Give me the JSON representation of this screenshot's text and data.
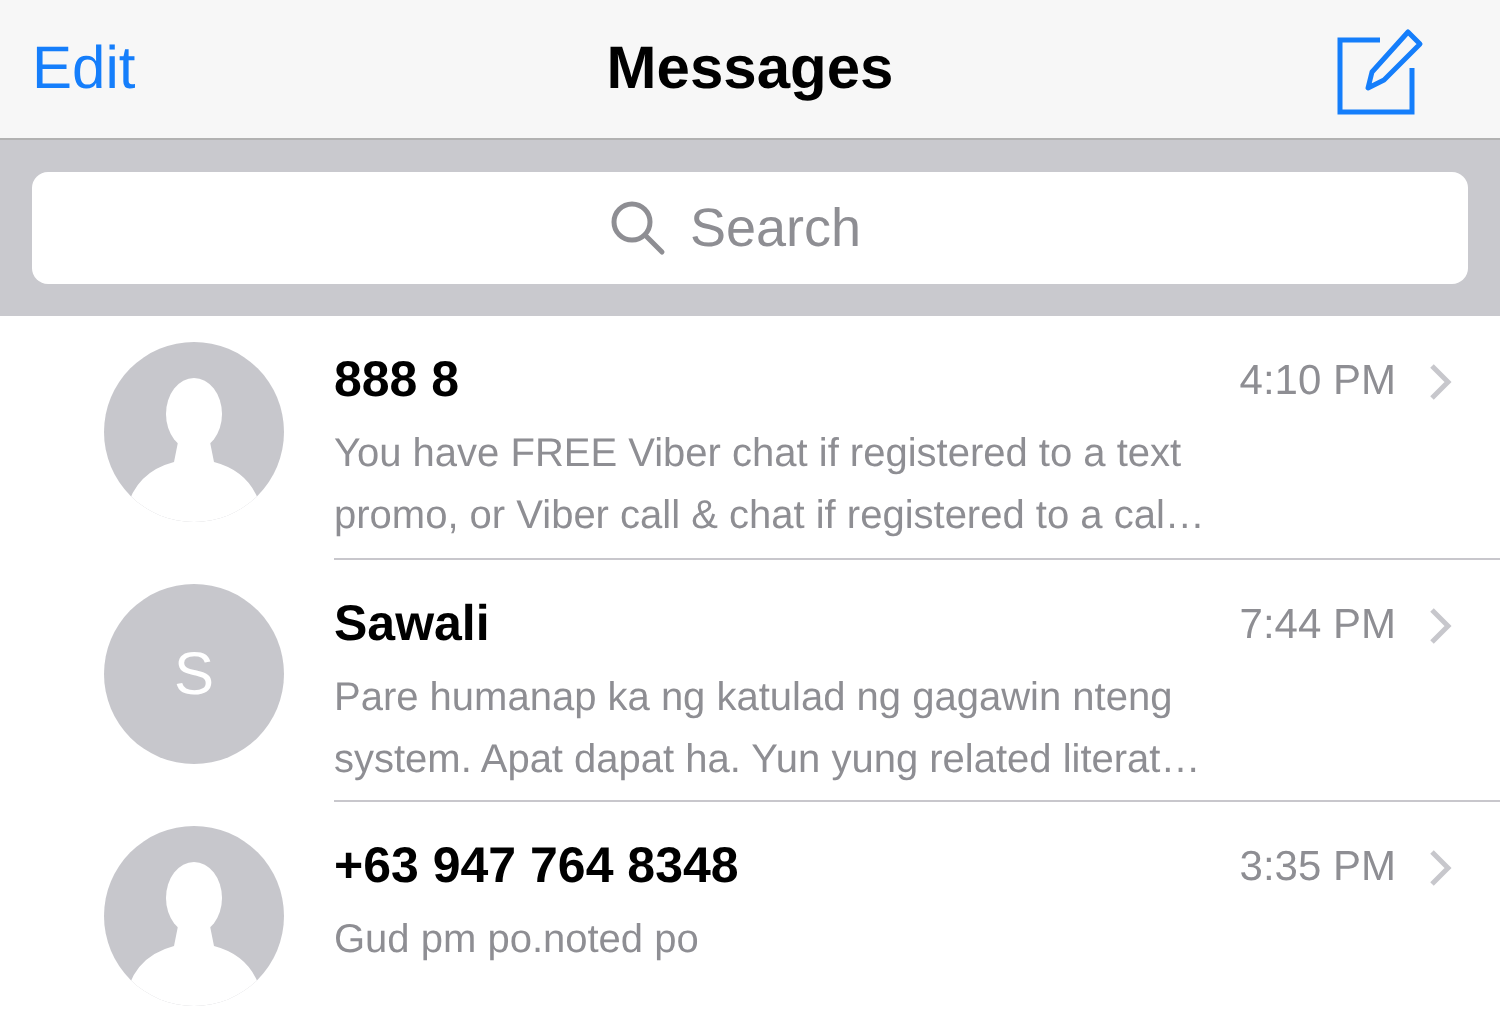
{
  "header": {
    "edit": "Edit",
    "title": "Messages"
  },
  "search": {
    "placeholder": "Search"
  },
  "conversations": [
    {
      "avatar": {
        "kind": "silhouette"
      },
      "name": "888 8",
      "time": "4:10 PM",
      "preview_lines": [
        "You have FREE Viber chat if registered to a text",
        "promo, or Viber call & chat if registered to a cal…"
      ]
    },
    {
      "avatar": {
        "kind": "initial",
        "text": "S"
      },
      "name": "Sawali",
      "time": "7:44 PM",
      "preview_lines": [
        "Pare humanap ka ng katulad ng gagawin nteng",
        "system. Apat dapat ha. Yun yung related literat…"
      ]
    },
    {
      "avatar": {
        "kind": "silhouette"
      },
      "name": "+63 947 764 8348",
      "time": "3:35 PM",
      "preview_lines": [
        "Gud pm po.noted po"
      ]
    }
  ]
}
